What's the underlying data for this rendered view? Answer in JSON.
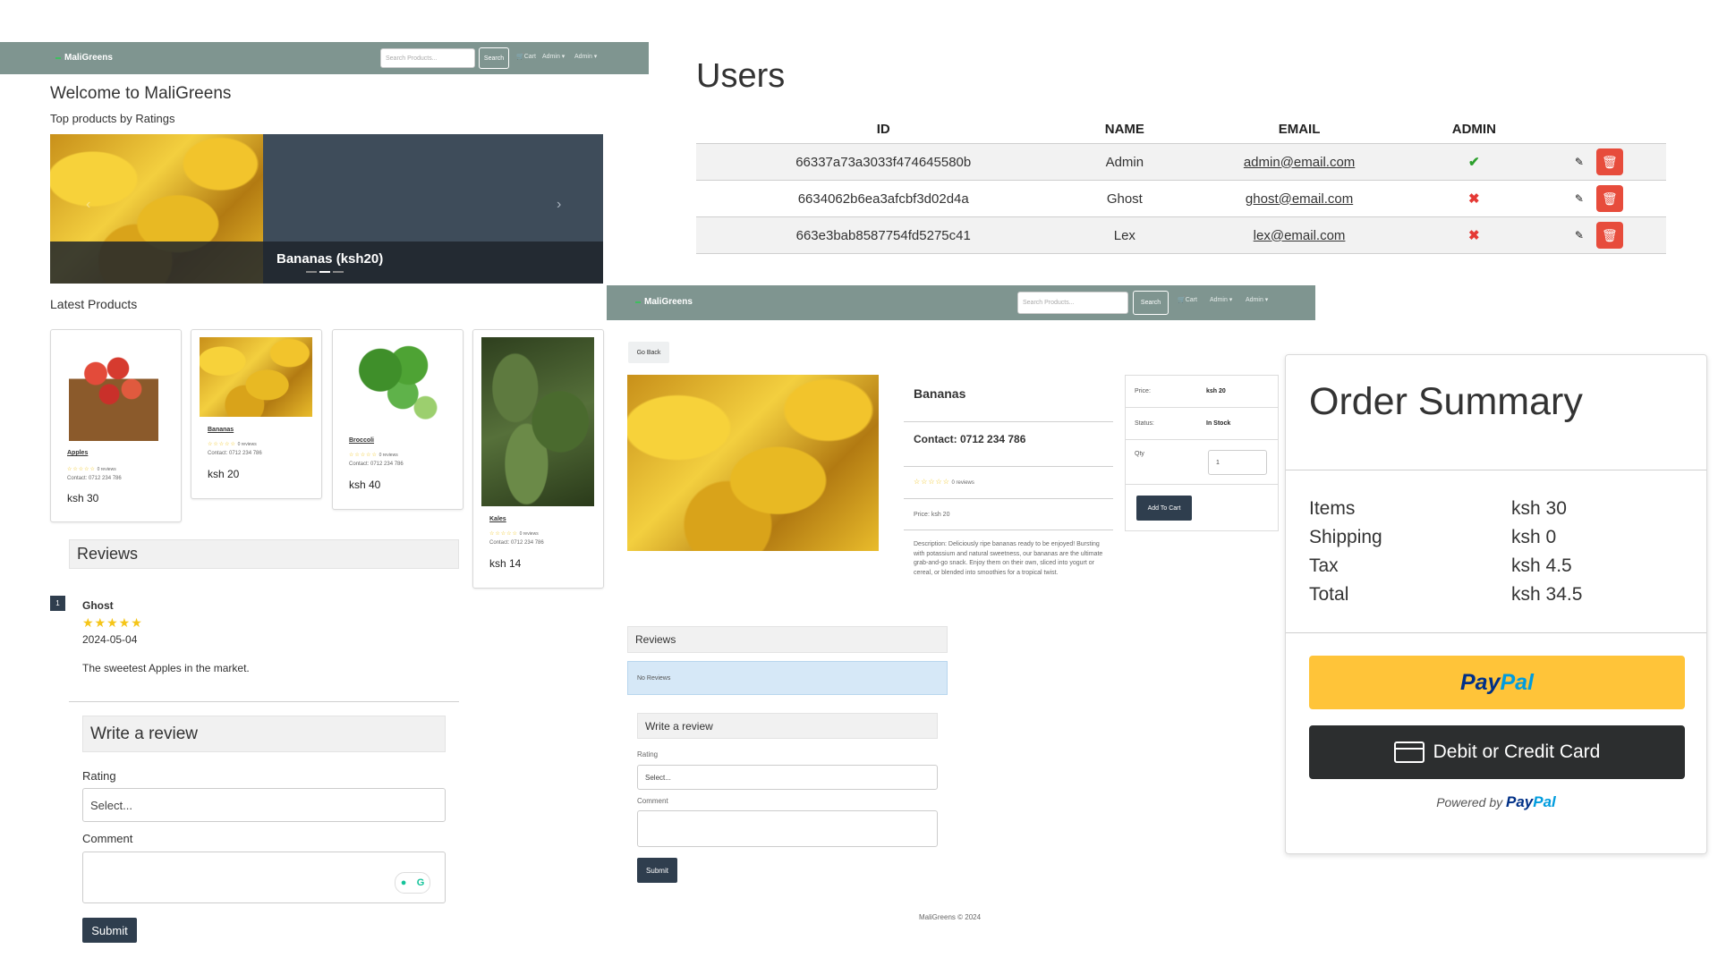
{
  "home": {
    "nav": {
      "brand": "MaliGreens",
      "search_placeholder": "Search Products...",
      "search_button": "Search",
      "cart": "Cart",
      "admin1": "Admin",
      "admin2": "Admin"
    },
    "welcome_title": "Welcome to MaliGreens",
    "top_products_label": "Top products by Ratings",
    "carousel_caption": "Bananas (ksh20)",
    "latest_products_label": "Latest Products",
    "products": [
      {
        "name": "Apples",
        "reviews": "0 reviews",
        "contact": "Contact: 0712 234 786",
        "price": "ksh 30",
        "stars": "☆☆☆☆☆"
      },
      {
        "name": "Bananas",
        "reviews": "0 reviews",
        "contact": "Contact: 0712 234 786",
        "price": "ksh 20",
        "stars": "☆☆☆☆☆"
      },
      {
        "name": "Broccoli",
        "reviews": "0 reviews",
        "contact": "Contact: 0712 234 786",
        "price": "ksh 40",
        "stars": "☆☆☆☆☆"
      },
      {
        "name": "Kales",
        "reviews": "0 reviews",
        "contact": "Contact: 0712 234 786",
        "price": "ksh 14",
        "stars": "☆☆☆☆☆"
      }
    ],
    "reviews_header": "Reviews",
    "review": {
      "badge": "1",
      "author": "Ghost",
      "stars": "★★★★★",
      "date": "2024-05-04",
      "comment": "The sweetest Apples in the market."
    },
    "write_review": {
      "title": "Write a review",
      "rating_label": "Rating",
      "rating_value": "Select...",
      "comment_label": "Comment",
      "submit": "Submit"
    }
  },
  "users": {
    "title": "Users",
    "columns": [
      "ID",
      "NAME",
      "EMAIL",
      "ADMIN"
    ],
    "rows": [
      {
        "id": "66337a73a3033f474645580b",
        "name": "Admin",
        "email": "admin@email.com",
        "admin": "✔"
      },
      {
        "id": "6634062b6ea3afcbf3d02d4a",
        "name": "Ghost",
        "email": "ghost@email.com",
        "admin": "✖"
      },
      {
        "id": "663e3bab8587754fd5275c41",
        "name": "Lex",
        "email": "lex@email.com",
        "admin": "✖"
      }
    ]
  },
  "detail": {
    "nav": {
      "brand": "MaliGreens",
      "search_placeholder": "Search Products...",
      "search_button": "Search",
      "cart": "Cart",
      "admin1": "Admin",
      "admin2": "Admin"
    },
    "go_back": "Go Back",
    "name": "Bananas",
    "contact": "Contact: 0712 234 786",
    "stars": "☆☆☆☆☆",
    "reviews_count": "0 reviews",
    "price_line": "Price: ksh 20",
    "description": "Description: Deliciously ripe bananas ready to be enjoyed! Bursting with potassium and natural sweetness, our bananas are the ultimate grab-and-go snack. Enjoy them on their own, sliced into yogurt or cereal, or blended into smoothies for a tropical twist.",
    "box": {
      "price_label": "Price:",
      "price_value": "ksh 20",
      "status_label": "Status:",
      "status_value": "In Stock",
      "qty_label": "Qty",
      "qty_value": "1",
      "add_to_cart": "Add To Cart"
    },
    "reviews_header": "Reviews",
    "no_reviews": "No Reviews",
    "write_review": {
      "title": "Write a review",
      "rating_label": "Rating",
      "rating_value": "Select...",
      "comment_label": "Comment",
      "submit": "Submit"
    },
    "footer": "MaliGreens © 2024"
  },
  "order_summary": {
    "title": "Order Summary",
    "rows": [
      {
        "label": "Items",
        "value": "ksh 30"
      },
      {
        "label": "Shipping",
        "value": "ksh 0"
      },
      {
        "label": "Tax",
        "value": "ksh 4.5"
      },
      {
        "label": "Total",
        "value": "ksh 34.5"
      }
    ],
    "paypal_pay": "Pay",
    "paypal_pal": "Pal",
    "card_button": "Debit or Credit Card",
    "powered_by": "Powered by",
    "powered_brand_pay": "Pay",
    "powered_brand_pal": "Pal",
    "paypal_yellow": "#ffc439",
    "card_dark": "#2c2e2f"
  }
}
